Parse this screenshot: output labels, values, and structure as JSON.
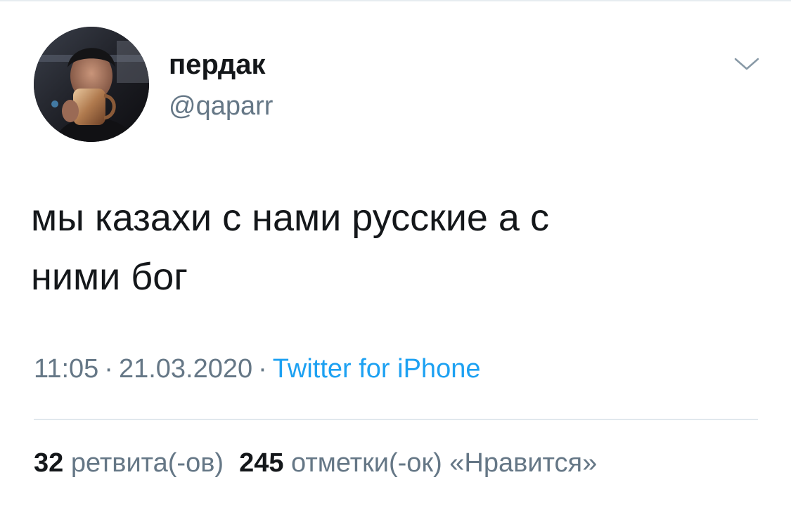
{
  "tweet": {
    "author": {
      "display_name": "пердак",
      "handle": "@qaparr"
    },
    "text_line1": "мы казахи с нами русские а с",
    "text_line2": "ними бог",
    "time": "11:05",
    "date": "21.03.2020",
    "separator": "·",
    "source": "Twitter for iPhone",
    "stats": {
      "retweets_count": "32",
      "retweets_label": "ретвита(-ов)",
      "likes_count": "245",
      "likes_label": "отметки(-ок) «Нравится»"
    }
  },
  "icons": {
    "menu": "chevron-down-icon"
  },
  "colors": {
    "text_primary": "#14171a",
    "text_secondary": "#657786",
    "link": "#1da1f2",
    "divider": "#e1e8ed"
  }
}
